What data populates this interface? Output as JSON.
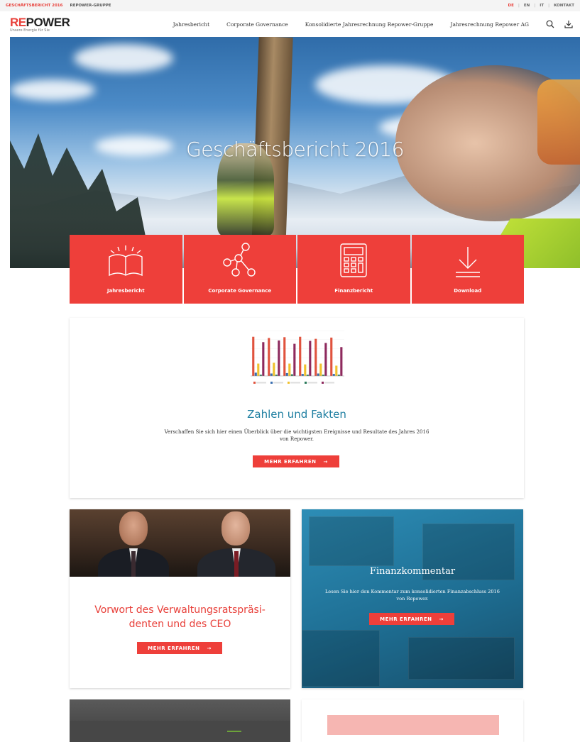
{
  "topbar": {
    "report_link": "GESCHÄFTSBERICHT 2016",
    "group_link": "REPOWER-GRUPPE",
    "languages": [
      "DE",
      "EN",
      "IT"
    ],
    "contact": "KONTAKT"
  },
  "header": {
    "logo_prefix": "RE",
    "logo_suffix": "POWER",
    "logo_tagline": "Unsere Energie für Sie",
    "nav": [
      "Jahresbericht",
      "Corporate Governance",
      "Konsolidierte Jahresrechnung Repower-Gruppe",
      "Jahresrechnung Repower AG"
    ],
    "icons": [
      "search-icon",
      "download-icon"
    ]
  },
  "hero": {
    "title": "Geschäftsbericht 2016"
  },
  "tiles": [
    {
      "label": "Jahresbericht",
      "icon": "book-icon"
    },
    {
      "label": "Corporate Governance",
      "icon": "network-icon"
    },
    {
      "label": "Finanzbericht",
      "icon": "calculator-icon"
    },
    {
      "label": "Download",
      "icon": "download-icon"
    }
  ],
  "zahlen": {
    "title": "Zahlen und Fakten",
    "text_line1": "Verschaffen Sie sich hier einen Überblick über die wichtigsten Ereignisse und Resultate des Jahres 2016",
    "text_line2": "von Repower.",
    "button": "MEHR ERFAHREN",
    "button_arrow": "→"
  },
  "chart_data": {
    "type": "bar",
    "categories": [
      "1",
      "2",
      "3",
      "4",
      "5",
      "6"
    ],
    "series": [
      {
        "values": [
          0.95,
          0.92,
          0.94,
          0.95,
          0.9,
          0.93
        ],
        "color": "#e0533e"
      },
      {
        "values": [
          0.08,
          0.06,
          0.07,
          0.05,
          0.06,
          0.05
        ],
        "color": "#3a6fb0"
      },
      {
        "values": [
          0.3,
          0.32,
          0.3,
          0.28,
          0.3,
          0.25
        ],
        "color": "#f0c12e"
      },
      {
        "values": [
          0.03,
          0.03,
          0.04,
          0.03,
          0.03,
          0.03
        ],
        "color": "#2a7a5a"
      },
      {
        "values": [
          0.82,
          0.86,
          0.78,
          0.85,
          0.8,
          0.7
        ],
        "color": "#8e2a5e"
      }
    ],
    "ylim": [
      0,
      1.1
    ]
  },
  "vorwort": {
    "title_line1": "Vorwort des Verwaltungsratspräsi-",
    "title_line2": "denten und des CEO",
    "button": "MEHR ERFAHREN",
    "button_arrow": "→"
  },
  "finanz": {
    "title": "Finanzkommentar",
    "text_line1": "Lesen Sie hier den Kommentar zum konsolidierten Finanzabschluss 2016",
    "text_line2": "von Repower.",
    "button": "MEHR ERFAHREN",
    "button_arrow": "→"
  },
  "colors": {
    "brand_red": "#ee3f3a",
    "accent_blue": "#1f7fa1"
  }
}
